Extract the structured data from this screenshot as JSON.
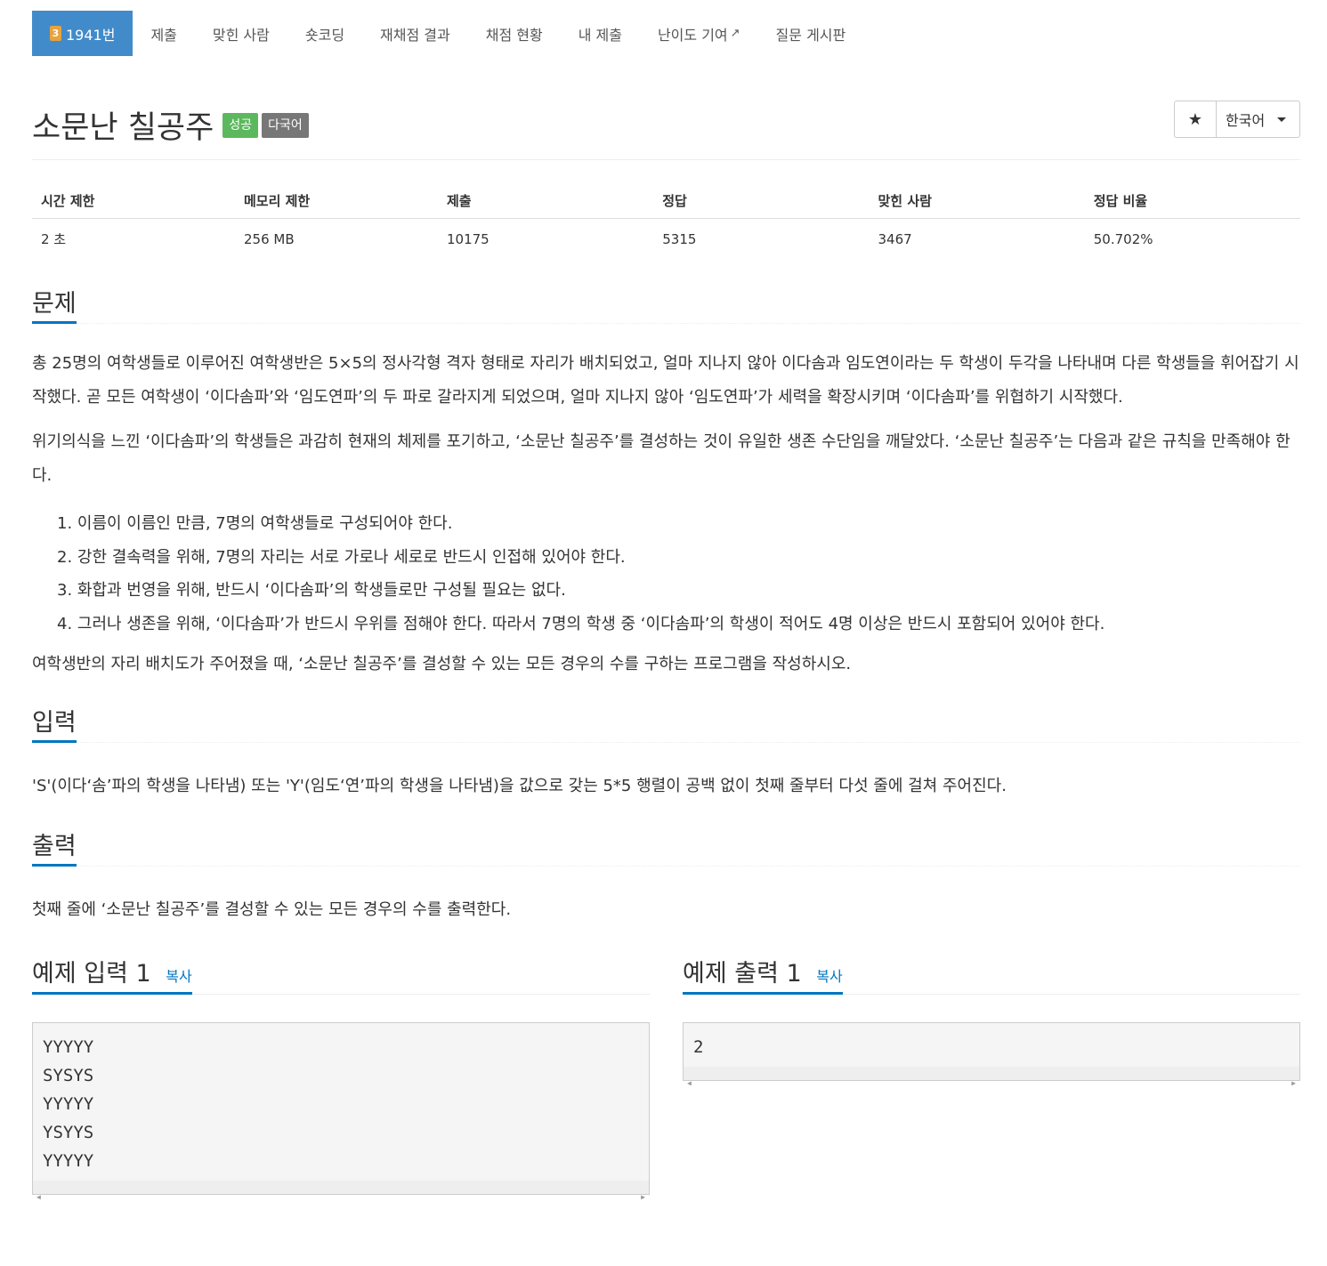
{
  "nav": {
    "tier": "3",
    "problem_number": "1941번",
    "items": [
      "제출",
      "맞힌 사람",
      "숏코딩",
      "재채점 결과",
      "채점 현황",
      "내 제출",
      "난이도 기여",
      "질문 게시판"
    ]
  },
  "problem": {
    "title": "소문난 칠공주",
    "badge_success": "성공",
    "badge_lang": "다국어",
    "star": "★",
    "language": "한국어"
  },
  "stats": {
    "headers": [
      "시간 제한",
      "메모리 제한",
      "제출",
      "정답",
      "맞힌 사람",
      "정답 비율"
    ],
    "values": [
      "2 초",
      "256 MB",
      "10175",
      "5315",
      "3467",
      "50.702%"
    ]
  },
  "sections": {
    "problem_heading": "문제",
    "problem_p1": "총 25명의 여학생들로 이루어진 여학생반은 5×5의 정사각형 격자 형태로 자리가 배치되었고, 얼마 지나지 않아 이다솜과 임도연이라는 두 학생이 두각을 나타내며 다른 학생들을 휘어잡기 시작했다. 곧 모든 여학생이 ‘이다솜파’와 ‘임도연파’의 두 파로 갈라지게 되었으며, 얼마 지나지 않아 ‘임도연파’가 세력을 확장시키며 ‘이다솜파’를 위협하기 시작했다.",
    "problem_p2": "위기의식을 느낀 ‘이다솜파’의 학생들은 과감히 현재의 체제를 포기하고, ‘소문난 칠공주’를 결성하는 것이 유일한 생존 수단임을 깨달았다. ‘소문난 칠공주’는 다음과 같은 규칙을 만족해야 한다.",
    "rules": [
      "1. 이름이 이름인 만큼, 7명의 여학생들로 구성되어야 한다.",
      "2. 강한 결속력을 위해, 7명의 자리는 서로 가로나 세로로 반드시 인접해 있어야 한다.",
      "3. 화합과 번영을 위해, 반드시 ‘이다솜파’의 학생들로만 구성될 필요는 없다.",
      "4. 그러나 생존을 위해, ‘이다솜파’가 반드시 우위를 점해야 한다. 따라서 7명의 학생 중 ‘이다솜파’의 학생이 적어도 4명 이상은 반드시 포함되어 있어야 한다."
    ],
    "problem_p3": "여학생반의 자리 배치도가 주어졌을 때, ‘소문난 칠공주’를 결성할 수 있는 모든 경우의 수를 구하는 프로그램을 작성하시오.",
    "input_heading": "입력",
    "input_text": "'S'(이다‘솜’파의 학생을 나타냄) 또는 'Y'(임도‘연’파의 학생을 나타냄)을 값으로 갖는 5*5 행렬이 공백 없이 첫째 줄부터 다섯 줄에 걸쳐 주어진다.",
    "output_heading": "출력",
    "output_text": "첫째 줄에 ‘소문난 칠공주’를 결성할 수 있는 모든 경우의 수를 출력한다."
  },
  "samples": {
    "input_title": "예제 입력 1",
    "output_title": "예제 출력 1",
    "copy_label": "복사",
    "input_text": "YYYYY\nSYSYS\nYYYYY\nYSYYS\nYYYYY",
    "output_text": "2"
  }
}
